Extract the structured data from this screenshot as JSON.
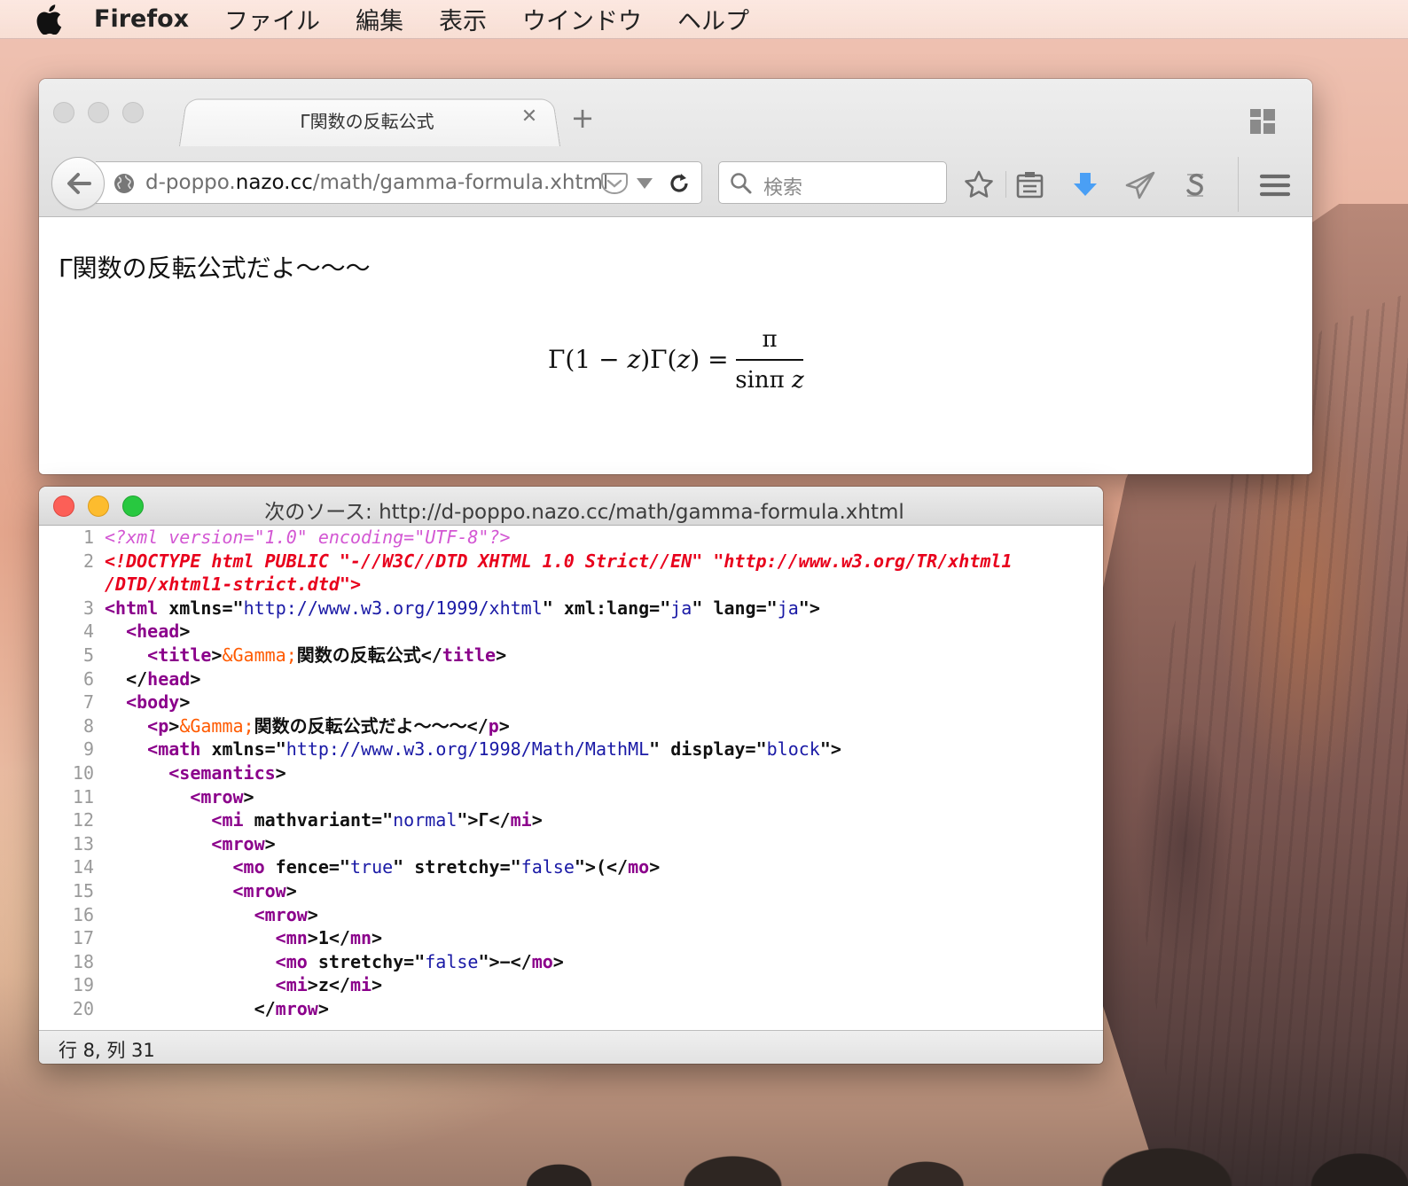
{
  "menubar": {
    "app": "Firefox",
    "items": [
      "ファイル",
      "編集",
      "表示",
      "ウインドウ",
      "ヘルプ"
    ]
  },
  "browser": {
    "tab_title": "Γ関数の反転公式",
    "url": {
      "prefix": "d-poppo.",
      "host": "nazo.cc",
      "path": "/math/gamma-formula.xhtml"
    },
    "search_placeholder": "検索",
    "page": {
      "paragraph": "Γ関数の反転公式だよ〜〜〜",
      "formula": {
        "lhs_g1": "Γ(1 − ",
        "lhs_z1": "z",
        "lhs_g2": ")Γ(",
        "lhs_z2": "z",
        "lhs_end": ") =",
        "numerator": "π",
        "den_a": "sinπ ",
        "den_z": "z"
      }
    }
  },
  "source_window": {
    "title": "次のソース: http://d-poppo.nazo.cc/math/gamma-formula.xhtml",
    "status": "行 8, 列 31",
    "lines": [
      {
        "n": "1",
        "parts": [
          {
            "c": "pi",
            "t": "<?xml version=\"1.0\" encoding=\"UTF-8\"?>"
          }
        ]
      },
      {
        "n": "2",
        "parts": [
          {
            "c": "dt",
            "t": "<!DOCTYPE html PUBLIC \"-//W3C//DTD XHTML 1.0 Strict//EN\" \"http://www.w3.org/TR/xhtml1"
          }
        ]
      },
      {
        "n": "",
        "parts": [
          {
            "c": "dt",
            "t": "/DTD/xhtml1-strict.dtd\">"
          }
        ]
      },
      {
        "n": "3",
        "parts": [
          {
            "c": "tag",
            "t": "<html"
          },
          {
            "c": "txt",
            "t": " "
          },
          {
            "c": "attr",
            "t": "xmlns"
          },
          {
            "c": "txt",
            "t": "=\""
          },
          {
            "c": "val",
            "t": "http://www.w3.org/1999/xhtml"
          },
          {
            "c": "txt",
            "t": "\" "
          },
          {
            "c": "attr",
            "t": "xml:lang"
          },
          {
            "c": "txt",
            "t": "=\""
          },
          {
            "c": "val",
            "t": "ja"
          },
          {
            "c": "txt",
            "t": "\" "
          },
          {
            "c": "attr",
            "t": "lang"
          },
          {
            "c": "txt",
            "t": "=\""
          },
          {
            "c": "val",
            "t": "ja"
          },
          {
            "c": "txt",
            "t": "\">"
          }
        ]
      },
      {
        "n": "4",
        "parts": [
          {
            "c": "txt",
            "t": "  "
          },
          {
            "c": "tag",
            "t": "<head"
          },
          {
            "c": "txt",
            "t": ">"
          }
        ]
      },
      {
        "n": "5",
        "parts": [
          {
            "c": "txt",
            "t": "    "
          },
          {
            "c": "tag",
            "t": "<title"
          },
          {
            "c": "txt",
            "t": ">"
          },
          {
            "c": "ent",
            "t": "&Gamma;"
          },
          {
            "c": "txt",
            "t": "関数の反転公式</"
          },
          {
            "c": "tag",
            "t": "title"
          },
          {
            "c": "txt",
            "t": ">"
          }
        ]
      },
      {
        "n": "6",
        "parts": [
          {
            "c": "txt",
            "t": "  </"
          },
          {
            "c": "tag",
            "t": "head"
          },
          {
            "c": "txt",
            "t": ">"
          }
        ]
      },
      {
        "n": "7",
        "parts": [
          {
            "c": "txt",
            "t": "  "
          },
          {
            "c": "tag",
            "t": "<body"
          },
          {
            "c": "txt",
            "t": ">"
          }
        ]
      },
      {
        "n": "8",
        "parts": [
          {
            "c": "txt",
            "t": "    "
          },
          {
            "c": "tag",
            "t": "<p"
          },
          {
            "c": "txt",
            "t": ">"
          },
          {
            "c": "ent",
            "t": "&Gamma;"
          },
          {
            "c": "txt",
            "t": "関数の反転公式だよ〜〜〜</"
          },
          {
            "c": "tag",
            "t": "p"
          },
          {
            "c": "txt",
            "t": ">"
          }
        ]
      },
      {
        "n": "9",
        "parts": [
          {
            "c": "txt",
            "t": "    "
          },
          {
            "c": "tag",
            "t": "<math"
          },
          {
            "c": "txt",
            "t": " "
          },
          {
            "c": "attr",
            "t": "xmlns"
          },
          {
            "c": "txt",
            "t": "=\""
          },
          {
            "c": "val",
            "t": "http://www.w3.org/1998/Math/MathML"
          },
          {
            "c": "txt",
            "t": "\" "
          },
          {
            "c": "attr",
            "t": "display"
          },
          {
            "c": "txt",
            "t": "=\""
          },
          {
            "c": "val",
            "t": "block"
          },
          {
            "c": "txt",
            "t": "\">"
          }
        ]
      },
      {
        "n": "10",
        "parts": [
          {
            "c": "txt",
            "t": "      "
          },
          {
            "c": "tag",
            "t": "<semantics"
          },
          {
            "c": "txt",
            "t": ">"
          }
        ]
      },
      {
        "n": "11",
        "parts": [
          {
            "c": "txt",
            "t": "        "
          },
          {
            "c": "tag",
            "t": "<mrow"
          },
          {
            "c": "txt",
            "t": ">"
          }
        ]
      },
      {
        "n": "12",
        "parts": [
          {
            "c": "txt",
            "t": "          "
          },
          {
            "c": "tag",
            "t": "<mi"
          },
          {
            "c": "txt",
            "t": " "
          },
          {
            "c": "attr",
            "t": "mathvariant"
          },
          {
            "c": "txt",
            "t": "=\""
          },
          {
            "c": "val",
            "t": "normal"
          },
          {
            "c": "txt",
            "t": "\">Γ</"
          },
          {
            "c": "tag",
            "t": "mi"
          },
          {
            "c": "txt",
            "t": ">"
          }
        ]
      },
      {
        "n": "13",
        "parts": [
          {
            "c": "txt",
            "t": "          "
          },
          {
            "c": "tag",
            "t": "<mrow"
          },
          {
            "c": "txt",
            "t": ">"
          }
        ]
      },
      {
        "n": "14",
        "parts": [
          {
            "c": "txt",
            "t": "            "
          },
          {
            "c": "tag",
            "t": "<mo"
          },
          {
            "c": "txt",
            "t": " "
          },
          {
            "c": "attr",
            "t": "fence"
          },
          {
            "c": "txt",
            "t": "=\""
          },
          {
            "c": "val",
            "t": "true"
          },
          {
            "c": "txt",
            "t": "\" "
          },
          {
            "c": "attr",
            "t": "stretchy"
          },
          {
            "c": "txt",
            "t": "=\""
          },
          {
            "c": "val",
            "t": "false"
          },
          {
            "c": "txt",
            "t": "\">(</"
          },
          {
            "c": "tag",
            "t": "mo"
          },
          {
            "c": "txt",
            "t": ">"
          }
        ]
      },
      {
        "n": "15",
        "parts": [
          {
            "c": "txt",
            "t": "            "
          },
          {
            "c": "tag",
            "t": "<mrow"
          },
          {
            "c": "txt",
            "t": ">"
          }
        ]
      },
      {
        "n": "16",
        "parts": [
          {
            "c": "txt",
            "t": "              "
          },
          {
            "c": "tag",
            "t": "<mrow"
          },
          {
            "c": "txt",
            "t": ">"
          }
        ]
      },
      {
        "n": "17",
        "parts": [
          {
            "c": "txt",
            "t": "                "
          },
          {
            "c": "tag",
            "t": "<mn"
          },
          {
            "c": "txt",
            "t": ">1</"
          },
          {
            "c": "tag",
            "t": "mn"
          },
          {
            "c": "txt",
            "t": ">"
          }
        ]
      },
      {
        "n": "18",
        "parts": [
          {
            "c": "txt",
            "t": "                "
          },
          {
            "c": "tag",
            "t": "<mo"
          },
          {
            "c": "txt",
            "t": " "
          },
          {
            "c": "attr",
            "t": "stretchy"
          },
          {
            "c": "txt",
            "t": "=\""
          },
          {
            "c": "val",
            "t": "false"
          },
          {
            "c": "txt",
            "t": "\">−</"
          },
          {
            "c": "tag",
            "t": "mo"
          },
          {
            "c": "txt",
            "t": ">"
          }
        ]
      },
      {
        "n": "19",
        "parts": [
          {
            "c": "txt",
            "t": "                "
          },
          {
            "c": "tag",
            "t": "<mi"
          },
          {
            "c": "txt",
            "t": ">z</"
          },
          {
            "c": "tag",
            "t": "mi"
          },
          {
            "c": "txt",
            "t": ">"
          }
        ]
      },
      {
        "n": "20",
        "parts": [
          {
            "c": "txt",
            "t": "              </"
          },
          {
            "c": "tag",
            "t": "mrow"
          },
          {
            "c": "txt",
            "t": ">"
          }
        ]
      }
    ]
  }
}
